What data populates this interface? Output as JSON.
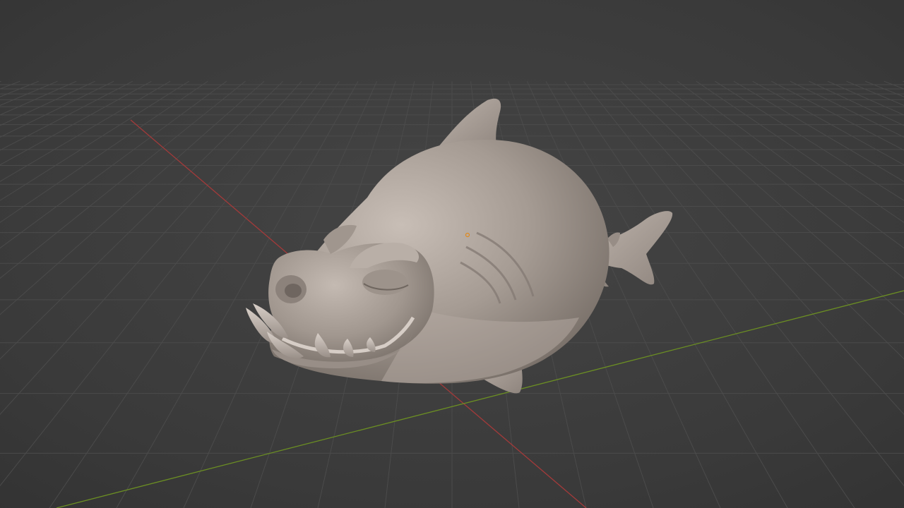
{
  "app": {
    "view": "3d-viewport-sculpt",
    "theme": {
      "background": "#3d3d3d",
      "grid_line": "#4a4a4a",
      "x_axis": "#a33a3a",
      "y_axis": "#6b8e23",
      "clay": "#a49a92",
      "clay_shadow": "#7d746d",
      "clay_highlight": "#c7bdb5",
      "origin_marker": "#e08a1e"
    }
  },
  "scene": {
    "object": "shark-sculpt",
    "shading": "matcap-clay",
    "show_grid": true,
    "show_axes": [
      "X",
      "Y"
    ]
  }
}
